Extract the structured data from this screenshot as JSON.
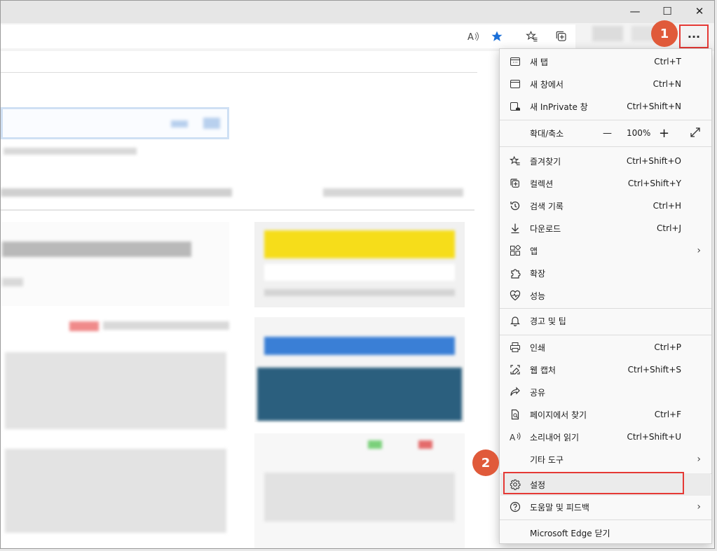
{
  "window": {
    "minimize_glyph": "—",
    "maximize_glyph": "☐",
    "close_glyph": "✕"
  },
  "toolbar": {
    "read_aloud_icon": "read-aloud-icon",
    "favorite_icon": "star-filled-icon",
    "favorites_icon": "favorites-icon",
    "collections_icon": "collections-icon",
    "more_label": "···"
  },
  "menu": {
    "items": [
      {
        "label": "새 탭",
        "shortcut": "Ctrl+T",
        "icon": "new-tab-icon"
      },
      {
        "label": "새 창에서",
        "shortcut": "Ctrl+N",
        "icon": "new-window-icon"
      },
      {
        "label": "새 InPrivate 창",
        "shortcut": "Ctrl+Shift+N",
        "icon": "inprivate-icon"
      },
      {
        "label": "확대/축소",
        "zoom_value": "100%",
        "minus": "—",
        "plus": "+",
        "icon": "fullscreen-icon"
      },
      {
        "label": "즐겨찾기",
        "shortcut": "Ctrl+Shift+O",
        "icon": "favorites-icon"
      },
      {
        "label": "컬렉션",
        "shortcut": "Ctrl+Shift+Y",
        "icon": "collections-icon"
      },
      {
        "label": "검색 기록",
        "shortcut": "Ctrl+H",
        "icon": "history-icon"
      },
      {
        "label": "다운로드",
        "shortcut": "Ctrl+J",
        "icon": "download-icon"
      },
      {
        "label": "앱",
        "icon": "apps-icon"
      },
      {
        "label": "확장",
        "icon": "extensions-icon"
      },
      {
        "label": "성능",
        "icon": "performance-icon"
      },
      {
        "label": "경고 및 팁",
        "icon": "bell-icon"
      },
      {
        "label": "인쇄",
        "shortcut": "Ctrl+P",
        "icon": "print-icon"
      },
      {
        "label": "웹 캡처",
        "shortcut": "Ctrl+Shift+S",
        "icon": "web-capture-icon"
      },
      {
        "label": "공유",
        "icon": "share-icon"
      },
      {
        "label": "페이지에서 찾기",
        "shortcut": "Ctrl+F",
        "icon": "find-icon"
      },
      {
        "label": "소리내어 읽기",
        "shortcut": "Ctrl+Shift+U",
        "icon": "read-aloud-icon"
      },
      {
        "label": "기타 도구",
        "icon": "more-tools-icon"
      },
      {
        "label": "설정",
        "icon": "gear-icon"
      },
      {
        "label": "도움말 및 피드백",
        "icon": "help-icon"
      },
      {
        "label": "Microsoft Edge 닫기",
        "icon": "close-edge-icon"
      }
    ]
  },
  "annotations": {
    "step1": "1",
    "step2": "2",
    "accent_color": "#e53935",
    "badge_color": "#e05a3a"
  }
}
